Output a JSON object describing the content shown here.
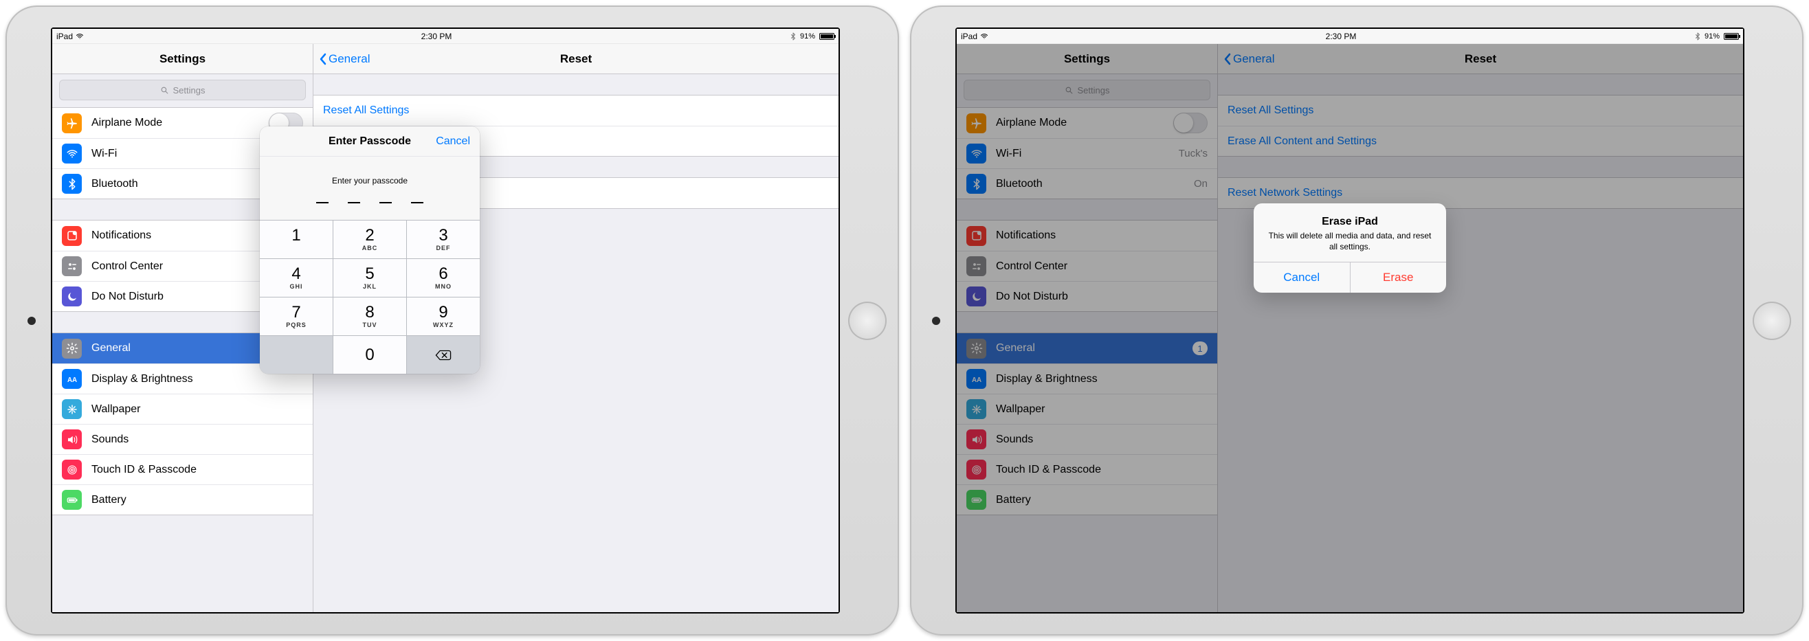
{
  "statusbar": {
    "device": "iPad",
    "time": "2:30 PM",
    "battery_pct": "91%"
  },
  "sidebar": {
    "title": "Settings",
    "search_placeholder": "Settings",
    "groups": [
      [
        {
          "icon": "airplane",
          "bg": "bg-orange",
          "label": "Airplane Mode",
          "accessory": "toggle"
        },
        {
          "icon": "wifi",
          "bg": "bg-blue",
          "label": "Wi-Fi",
          "value": "Tuck's"
        },
        {
          "icon": "bluetooth",
          "bg": "bg-blue",
          "label": "Bluetooth",
          "value": "On"
        }
      ],
      [
        {
          "icon": "notify",
          "bg": "bg-red",
          "label": "Notifications"
        },
        {
          "icon": "control",
          "bg": "bg-gray",
          "label": "Control Center"
        },
        {
          "icon": "moon",
          "bg": "bg-purple",
          "label": "Do Not Disturb"
        }
      ],
      [
        {
          "icon": "gear",
          "bg": "bg-gray",
          "label": "General",
          "selected": true,
          "badge": "1"
        },
        {
          "icon": "aa",
          "bg": "bg-blue",
          "label": "Display & Brightness"
        },
        {
          "icon": "flower",
          "bg": "bg-teal",
          "label": "Wallpaper"
        },
        {
          "icon": "speaker",
          "bg": "bg-pink",
          "label": "Sounds"
        },
        {
          "icon": "touchid",
          "bg": "bg-pink",
          "label": "Touch ID & Passcode"
        },
        {
          "icon": "battery",
          "bg": "bg-green",
          "label": "Battery"
        }
      ]
    ]
  },
  "detail": {
    "back": "General",
    "title": "Reset",
    "links": [
      [
        "Reset All Settings",
        "Erase All Content and Settings"
      ],
      [
        "Reset Network Settings"
      ]
    ]
  },
  "passcode": {
    "title": "Enter Passcode",
    "cancel": "Cancel",
    "prompt": "Enter your passcode",
    "keys": [
      [
        {
          "n": "1",
          "l": ""
        },
        {
          "n": "2",
          "l": "ABC"
        },
        {
          "n": "3",
          "l": "DEF"
        }
      ],
      [
        {
          "n": "4",
          "l": "GHI"
        },
        {
          "n": "5",
          "l": "JKL"
        },
        {
          "n": "6",
          "l": "MNO"
        }
      ],
      [
        {
          "n": "7",
          "l": "PQRS"
        },
        {
          "n": "8",
          "l": "TUV"
        },
        {
          "n": "9",
          "l": "WXYZ"
        }
      ]
    ],
    "zero": "0"
  },
  "alert": {
    "title": "Erase iPad",
    "message": "This will delete all media and data, and reset all settings.",
    "cancel": "Cancel",
    "confirm": "Erase"
  },
  "left_wifi_value": "Tuc"
}
